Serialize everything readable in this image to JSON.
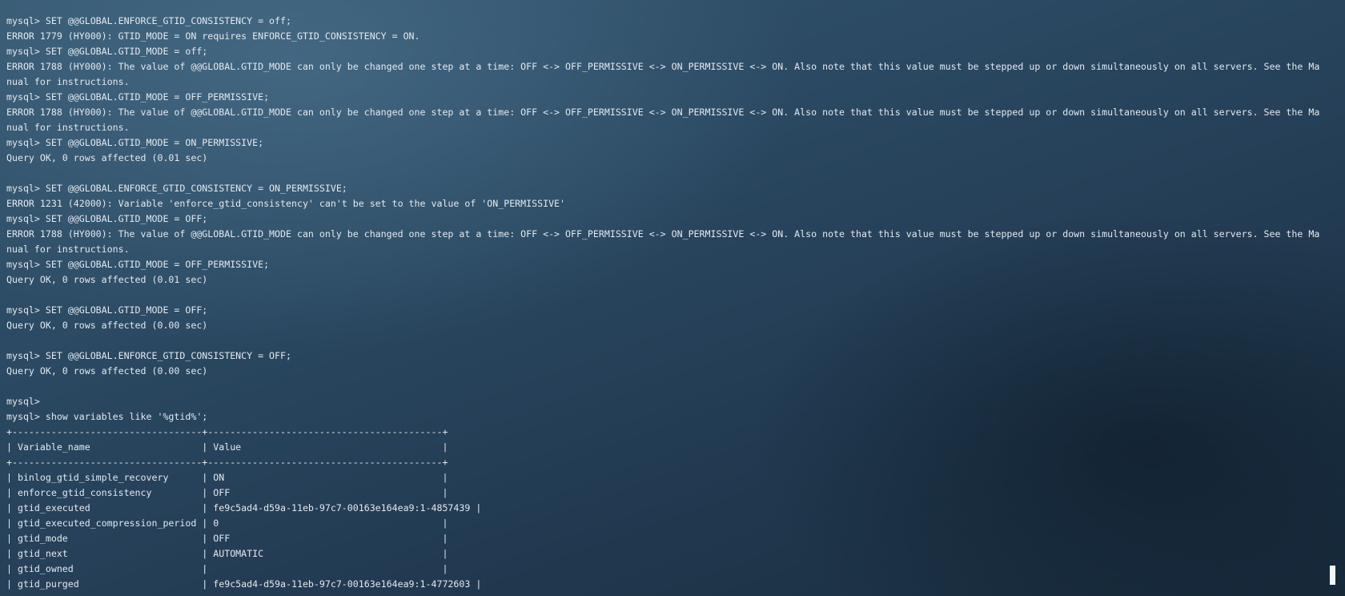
{
  "terminal": {
    "lines": [
      "mysql> SET @@GLOBAL.ENFORCE_GTID_CONSISTENCY = off;",
      "ERROR 1779 (HY000): GTID_MODE = ON requires ENFORCE_GTID_CONSISTENCY = ON.",
      "mysql> SET @@GLOBAL.GTID_MODE = off;",
      "ERROR 1788 (HY000): The value of @@GLOBAL.GTID_MODE can only be changed one step at a time: OFF <-> OFF_PERMISSIVE <-> ON_PERMISSIVE <-> ON. Also note that this value must be stepped up or down simultaneously on all servers. See the Ma",
      "nual for instructions.",
      "mysql> SET @@GLOBAL.GTID_MODE = OFF_PERMISSIVE;",
      "ERROR 1788 (HY000): The value of @@GLOBAL.GTID_MODE can only be changed one step at a time: OFF <-> OFF_PERMISSIVE <-> ON_PERMISSIVE <-> ON. Also note that this value must be stepped up or down simultaneously on all servers. See the Ma",
      "nual for instructions.",
      "mysql> SET @@GLOBAL.GTID_MODE = ON_PERMISSIVE;",
      "Query OK, 0 rows affected (0.01 sec)",
      "",
      "mysql> SET @@GLOBAL.ENFORCE_GTID_CONSISTENCY = ON_PERMISSIVE;",
      "ERROR 1231 (42000): Variable 'enforce_gtid_consistency' can't be set to the value of 'ON_PERMISSIVE'",
      "mysql> SET @@GLOBAL.GTID_MODE = OFF;",
      "ERROR 1788 (HY000): The value of @@GLOBAL.GTID_MODE can only be changed one step at a time: OFF <-> OFF_PERMISSIVE <-> ON_PERMISSIVE <-> ON. Also note that this value must be stepped up or down simultaneously on all servers. See the Ma",
      "nual for instructions.",
      "mysql> SET @@GLOBAL.GTID_MODE = OFF_PERMISSIVE;",
      "Query OK, 0 rows affected (0.01 sec)",
      "",
      "mysql> SET @@GLOBAL.GTID_MODE = OFF;",
      "Query OK, 0 rows affected (0.00 sec)",
      "",
      "mysql> SET @@GLOBAL.ENFORCE_GTID_CONSISTENCY = OFF;",
      "Query OK, 0 rows affected (0.00 sec)",
      "",
      "mysql>",
      "mysql> show variables like '%gtid%';",
      "+----------------------------------+------------------------------------------+",
      "| Variable_name                    | Value                                    |",
      "+----------------------------------+------------------------------------------+",
      "| binlog_gtid_simple_recovery      | ON                                       |",
      "| enforce_gtid_consistency         | OFF                                      |",
      "| gtid_executed                    | fe9c5ad4-d59a-11eb-97c7-00163e164ea9:1-4857439 |",
      "| gtid_executed_compression_period | 0                                        |",
      "| gtid_mode                        | OFF                                      |",
      "| gtid_next                        | AUTOMATIC                                |",
      "| gtid_owned                       |                                          |",
      "| gtid_purged                      | fe9c5ad4-d59a-11eb-97c7-00163e164ea9:1-4772603 |"
    ]
  }
}
